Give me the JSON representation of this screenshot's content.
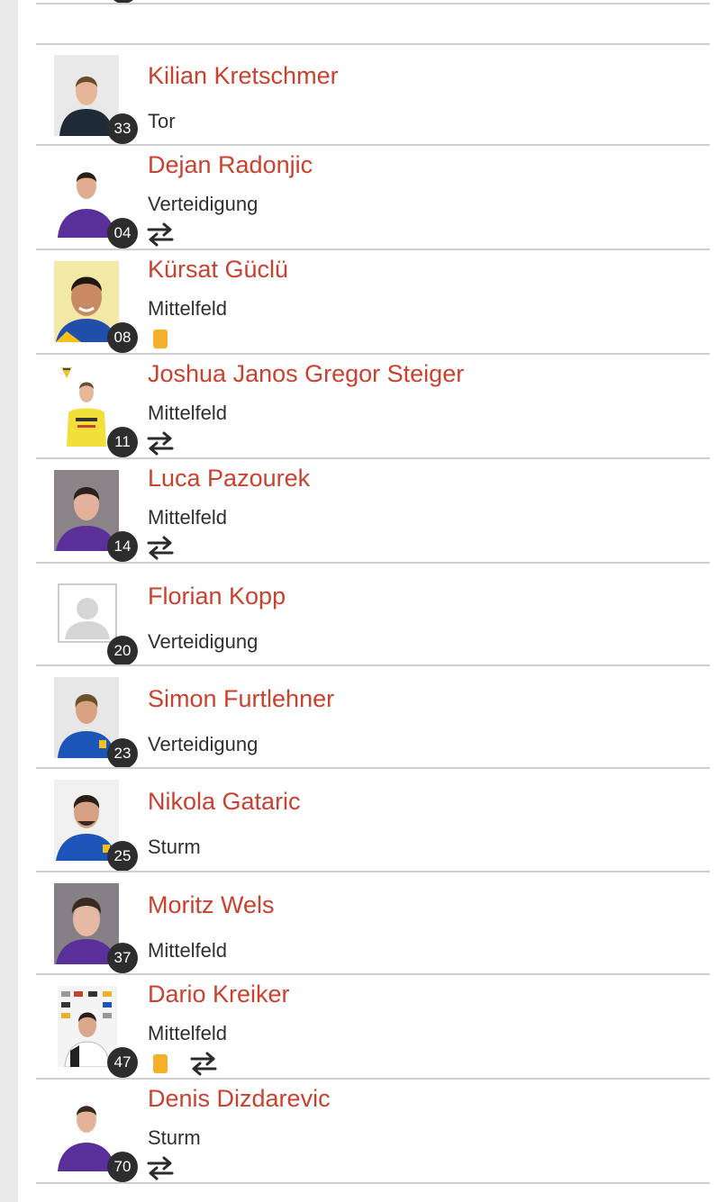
{
  "players": [
    {
      "name": "Kilian Kretschmer",
      "position": "Tor",
      "number": "33",
      "yellow_card": false,
      "substitution": false,
      "photo": "keeper-portrait"
    },
    {
      "name": "Dejan Radonjic",
      "position": "Verteidigung",
      "number": "04",
      "yellow_card": false,
      "substitution": true,
      "photo": "purple-kit-portrait"
    },
    {
      "name": "Kürsat Güclü",
      "position": "Mittelfeld",
      "number": "08",
      "yellow_card": true,
      "substitution": false,
      "photo": "yellow-background-portrait"
    },
    {
      "name": "Joshua Janos Gregor Steiger",
      "position": "Mittelfeld",
      "number": "11",
      "yellow_card": false,
      "substitution": true,
      "photo": "yellow-kit-portrait"
    },
    {
      "name": "Luca Pazourek",
      "position": "Mittelfeld",
      "number": "14",
      "yellow_card": false,
      "substitution": true,
      "photo": "purple-kit-portrait"
    },
    {
      "name": "Florian Kopp",
      "position": "Verteidigung",
      "number": "20",
      "yellow_card": false,
      "substitution": false,
      "photo": "placeholder-avatar"
    },
    {
      "name": "Simon Furtlehner",
      "position": "Verteidigung",
      "number": "23",
      "yellow_card": false,
      "substitution": false,
      "photo": "blue-kit-portrait"
    },
    {
      "name": "Nikola Gataric",
      "position": "Sturm",
      "number": "25",
      "yellow_card": false,
      "substitution": false,
      "photo": "blue-kit-portrait"
    },
    {
      "name": "Moritz Wels",
      "position": "Mittelfeld",
      "number": "37",
      "yellow_card": false,
      "substitution": false,
      "photo": "purple-kit-portrait"
    },
    {
      "name": "Dario Kreiker",
      "position": "Mittelfeld",
      "number": "47",
      "yellow_card": true,
      "substitution": true,
      "photo": "sponsor-wall-portrait"
    },
    {
      "name": "Denis Dizdarevic",
      "position": "Sturm",
      "number": "70",
      "yellow_card": false,
      "substitution": true,
      "photo": "purple-kit-portrait"
    }
  ],
  "colors": {
    "name": "#c9412f",
    "position_text": "#2f2f2f",
    "number_badge": "#2d2d2d",
    "yellow_card": "#f4b02a",
    "divider": "#cfcfcf",
    "gutter": "#e9e9e9"
  },
  "icons": {
    "substitution": "substitution-icon",
    "yellow_card": "yellow-card-icon"
  }
}
